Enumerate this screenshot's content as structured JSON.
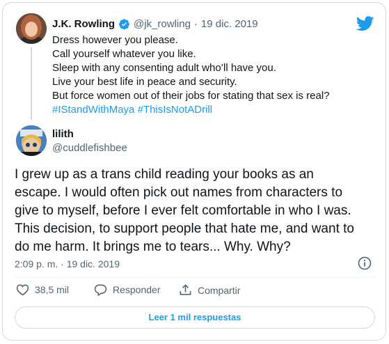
{
  "quoted": {
    "name": "J.K. Rowling",
    "handle": "@jk_rowling",
    "separator": "·",
    "date": "19 dic. 2019",
    "lines": [
      "Dress however you please.",
      "Call yourself whatever you like.",
      "Sleep with any consenting adult who’ll have you.",
      "Live your best life in peace and security.",
      "But force women out of their jobs for stating that sex is real?"
    ],
    "hashtags": [
      "#IStandWithMaya",
      "#ThisIsNotADrill"
    ]
  },
  "reply": {
    "name": "lilith",
    "handle": "@cuddlefishbee",
    "text_lines": [
      "I grew up as a trans child reading your books as an",
      "escape. I would often pick out names from characters to",
      "give to myself, before I ever felt comfortable in who I was.",
      "This decision, to support people that hate me, and want to",
      "do me harm. It brings me to tears... Why. Why?"
    ],
    "timestamp": "2:09 p. m. · 19 dic. 2019"
  },
  "actions": {
    "like_count": "38,5 mil",
    "reply_label": "Responder",
    "share_label": "Compartir"
  },
  "read_replies_label": "Leer 1 mil respuestas",
  "icons": {
    "brand": "twitter-bird-icon",
    "verified": "verified-badge-icon",
    "info": "info-icon",
    "like": "heart-icon",
    "reply": "speech-bubble-icon",
    "share": "share-icon"
  },
  "colors": {
    "accent": "#1d9bf0",
    "text": "#0f1419",
    "muted": "#536471",
    "border": "#cfd9de"
  }
}
